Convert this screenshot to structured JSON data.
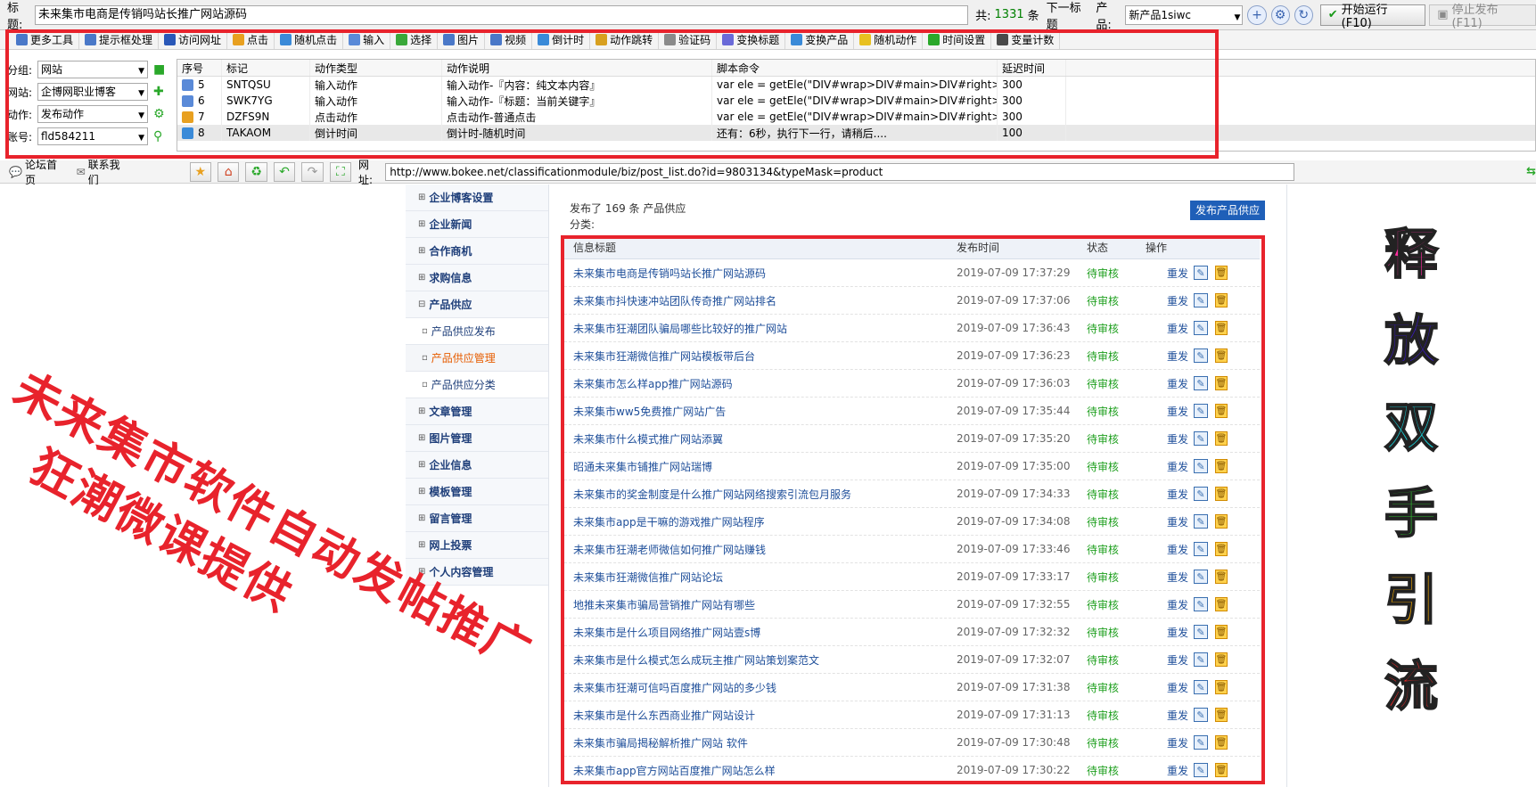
{
  "topbar": {
    "title_label": "标题:",
    "title_value": "未来集市电商是传销吗站长推广网站源码",
    "count_label": "共:",
    "count_value": "1331",
    "count_unit": "条",
    "next_title": "下一标题",
    "product_label": "产品:",
    "product_value": "新产品1siwc",
    "run_button": "开始运行 (F10)",
    "stop_button": "停止发布 (F11)"
  },
  "toolbar": {
    "items": [
      "更多工具",
      "提示框处理",
      "访问网址",
      "点击",
      "随机点击",
      "输入",
      "选择",
      "图片",
      "视频",
      "倒计时",
      "动作跳转",
      "验证码",
      "变换标题",
      "变换产品",
      "随机动作",
      "时间设置",
      "变量计数"
    ],
    "colors": [
      "#4a78c8",
      "#4a78c8",
      "#2a58b8",
      "#e8a020",
      "#3a8ad8",
      "#5a8ad8",
      "#3aa83a",
      "#4a78c8",
      "#4a78c8",
      "#3a8ad8",
      "#d8a020",
      "#8a8a8a",
      "#6a6ad8",
      "#3a8ad8",
      "#e8c020",
      "#2aa82a",
      "#4a4a4a"
    ]
  },
  "filters": {
    "group_label": "分组:",
    "group_value": "网站",
    "site_label": "网站:",
    "site_value": "企博网职业博客",
    "action_label": "动作:",
    "action_value": "发布动作",
    "account_label": "账号:",
    "account_value": "fld584211"
  },
  "script_table": {
    "headers": [
      "序号",
      "标记",
      "动作类型",
      "动作说明",
      "脚本命令",
      "延迟时间"
    ],
    "rows": [
      {
        "no": "5",
        "tag": "SNTQSU",
        "type": "输入动作",
        "desc": "输入动作-『内容：纯文本内容』",
        "cmd": "var ele = getEle(\"DIV#wrap>DIV#main>DIV#right>...",
        "delay": "300"
      },
      {
        "no": "6",
        "tag": "SWK7YG",
        "type": "输入动作",
        "desc": "输入动作-『标题：当前关键字』",
        "cmd": "var ele = getEle(\"DIV#wrap>DIV#main>DIV#right>...",
        "delay": "300"
      },
      {
        "no": "7",
        "tag": "DZFS9N",
        "type": "点击动作",
        "desc": "点击动作-普通点击",
        "cmd": "var ele = getEle(\"DIV#wrap>DIV#main>DIV#right>...",
        "delay": "300"
      },
      {
        "no": "8",
        "tag": "TAKAOM",
        "type": "倒计时间",
        "desc": "倒计时-随机时间",
        "cmd": "还有：6秒，执行下一行，请稍后....",
        "delay": "100"
      }
    ]
  },
  "navbar": {
    "forum_home": "论坛首页",
    "contact_us": "联系我们",
    "url_label": "网址:",
    "url_value": "http://www.bokee.net/classificationmodule/biz/post_list.do?id=9803134&typeMask=product"
  },
  "side_nav": [
    {
      "label": "企业博客设置",
      "kind": "top"
    },
    {
      "label": "企业新闻",
      "kind": "top"
    },
    {
      "label": "合作商机",
      "kind": "top"
    },
    {
      "label": "求购信息",
      "kind": "top"
    },
    {
      "label": "产品供应",
      "kind": "open"
    },
    {
      "label": "产品供应发布",
      "kind": "sub"
    },
    {
      "label": "产品供应管理",
      "kind": "active"
    },
    {
      "label": "产品供应分类",
      "kind": "sub"
    },
    {
      "label": "文章管理",
      "kind": "top"
    },
    {
      "label": "图片管理",
      "kind": "top"
    },
    {
      "label": "企业信息",
      "kind": "top"
    },
    {
      "label": "模板管理",
      "kind": "top"
    },
    {
      "label": "留言管理",
      "kind": "top"
    },
    {
      "label": "网上投票",
      "kind": "top"
    },
    {
      "label": "个人内容管理",
      "kind": "top"
    }
  ],
  "content": {
    "published_info": "发布了 169 条 产品供应",
    "category_label": "分类:",
    "publish_button": "发布产品供应",
    "headers": {
      "title": "信息标题",
      "time": "发布时间",
      "status": "状态",
      "action": "操作"
    },
    "redo_label": "重发",
    "rows": [
      {
        "title": "未来集市电商是传销吗站长推广网站源码",
        "time": "2019-07-09 17:37:29",
        "status": "待审核"
      },
      {
        "title": "未来集市抖快速冲站团队传奇推广网站排名",
        "time": "2019-07-09 17:37:06",
        "status": "待审核"
      },
      {
        "title": "未来集市狂潮团队骗局哪些比较好的推广网站",
        "time": "2019-07-09 17:36:43",
        "status": "待审核"
      },
      {
        "title": "未来集市狂潮微信推广网站模板带后台",
        "time": "2019-07-09 17:36:23",
        "status": "待审核"
      },
      {
        "title": "未来集市怎么样app推广网站源码",
        "time": "2019-07-09 17:36:03",
        "status": "待审核"
      },
      {
        "title": "未来集市ww5免费推广网站广告",
        "time": "2019-07-09 17:35:44",
        "status": "待审核"
      },
      {
        "title": "未来集市什么模式推广网站添翼",
        "time": "2019-07-09 17:35:20",
        "status": "待审核"
      },
      {
        "title": "昭通未来集市铺推广网站瑞博",
        "time": "2019-07-09 17:35:00",
        "status": "待审核"
      },
      {
        "title": "未来集市的奖金制度是什么推广网站网络搜索引流包月服务",
        "time": "2019-07-09 17:34:33",
        "status": "待审核"
      },
      {
        "title": "未来集市app是干嘛的游戏推广网站程序",
        "time": "2019-07-09 17:34:08",
        "status": "待审核"
      },
      {
        "title": "未来集市狂潮老师微信如何推广网站赚钱",
        "time": "2019-07-09 17:33:46",
        "status": "待审核"
      },
      {
        "title": "未来集市狂潮微信推广网站论坛",
        "time": "2019-07-09 17:33:17",
        "status": "待审核"
      },
      {
        "title": "地推未来集市骗局营销推广网站有哪些",
        "time": "2019-07-09 17:32:55",
        "status": "待审核"
      },
      {
        "title": "未来集市是什么项目网络推广网站壹s博",
        "time": "2019-07-09 17:32:32",
        "status": "待审核"
      },
      {
        "title": "未来集市是什么模式怎么成玩主推广网站策划案范文",
        "time": "2019-07-09 17:32:07",
        "status": "待审核"
      },
      {
        "title": "未来集市狂潮可信吗百度推广网站的多少钱",
        "time": "2019-07-09 17:31:38",
        "status": "待审核"
      },
      {
        "title": "未来集市是什么东西商业推广网站设计",
        "time": "2019-07-09 17:31:13",
        "status": "待审核"
      },
      {
        "title": "未来集市骗局揭秘解析推广网站 软件",
        "time": "2019-07-09 17:30:48",
        "status": "待审核"
      },
      {
        "title": "未来集市app官方网站百度推广网站怎么样",
        "time": "2019-07-09 17:30:22",
        "status": "待审核"
      }
    ]
  },
  "watermark": {
    "line1": "未来集市软件自动发帖推广",
    "line2": "狂潮微课提供",
    "vertical": [
      "释",
      "放",
      "双",
      "手",
      "引",
      "流"
    ],
    "vertical_colors": [
      "#ff2ea0",
      "#3a18c8",
      "#19d8e0",
      "#2fb82f",
      "#ffb000",
      "#ff2a2a"
    ]
  }
}
